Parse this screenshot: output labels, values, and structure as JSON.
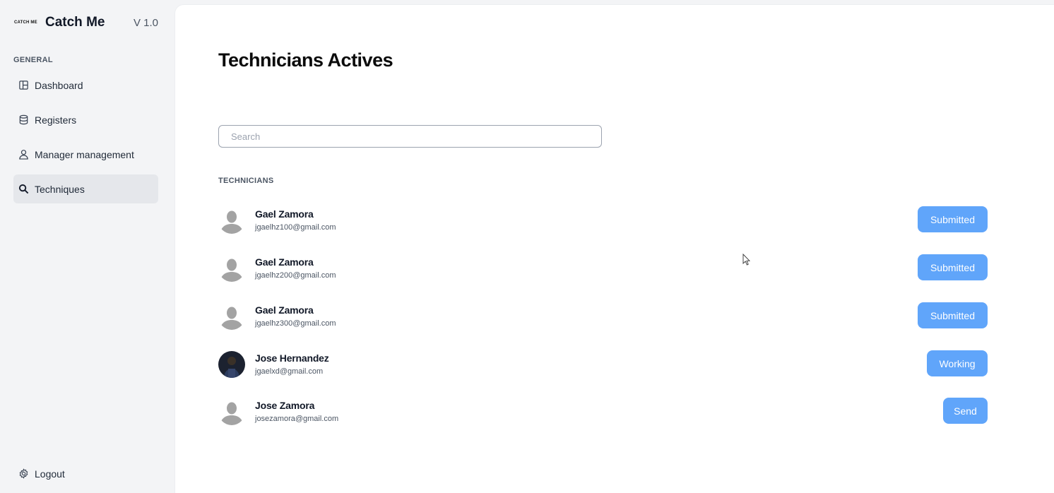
{
  "brand": {
    "logo_text": "CATCH ME",
    "name": "Catch Me",
    "version": "V 1.0"
  },
  "sidebar": {
    "section_label": "GENERAL",
    "items": [
      {
        "label": "Dashboard",
        "icon": "layout-icon"
      },
      {
        "label": "Registers",
        "icon": "database-icon"
      },
      {
        "label": "Manager management",
        "icon": "user-icon"
      },
      {
        "label": "Techniques",
        "icon": "search-icon",
        "active": true
      }
    ],
    "logout_label": "Logout"
  },
  "main": {
    "title": "Technicians Actives",
    "search_placeholder": "Search",
    "list_label": "TECHNICIANS",
    "technicians": [
      {
        "name": "Gael Zamora",
        "email": "jgaelhz100@gmail.com",
        "status": "Submitted",
        "avatar": "default-avatar"
      },
      {
        "name": "Gael Zamora",
        "email": "jgaelhz200@gmail.com",
        "status": "Submitted",
        "avatar": "default-avatar"
      },
      {
        "name": "Gael Zamora",
        "email": "jgaelhz300@gmail.com",
        "status": "Submitted",
        "avatar": "default-avatar"
      },
      {
        "name": "Jose Hernandez",
        "email": "jgaelxd@gmail.com",
        "status": "Working",
        "avatar": "photo-avatar"
      },
      {
        "name": "Jose Zamora",
        "email": "josezamora@gmail.com",
        "status": "Send",
        "avatar": "default-avatar"
      }
    ]
  },
  "colors": {
    "accent": "#60a5fa",
    "sidebar_bg": "#f3f4f6",
    "active_item_bg": "#e5e7eb",
    "panel_bg": "#ffffff"
  }
}
